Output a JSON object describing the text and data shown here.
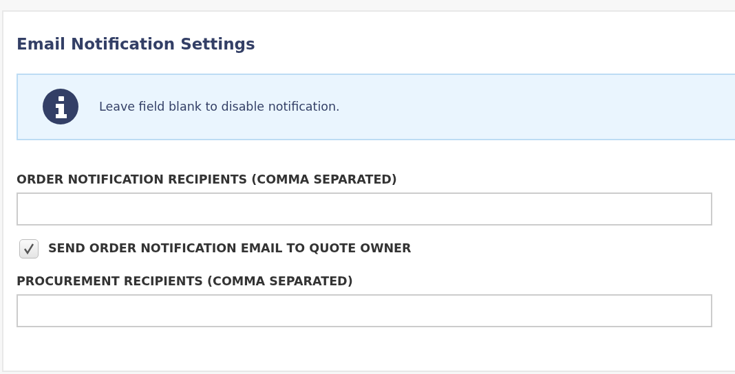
{
  "title": "Email Notification Settings",
  "info": {
    "text": "Leave field blank to disable notification."
  },
  "fields": [
    {
      "kind": "text",
      "label": "ORDER NOTIFICATION RECIPIENTS (COMMA SEPARATED)"
    },
    {
      "kind": "checkbox",
      "label": "SEND ORDER NOTIFICATION EMAIL TO QUOTE OWNER",
      "checked": true
    },
    {
      "kind": "text",
      "label": "PROCUREMENT RECIPIENTS (COMMA SEPARATED)"
    }
  ]
}
